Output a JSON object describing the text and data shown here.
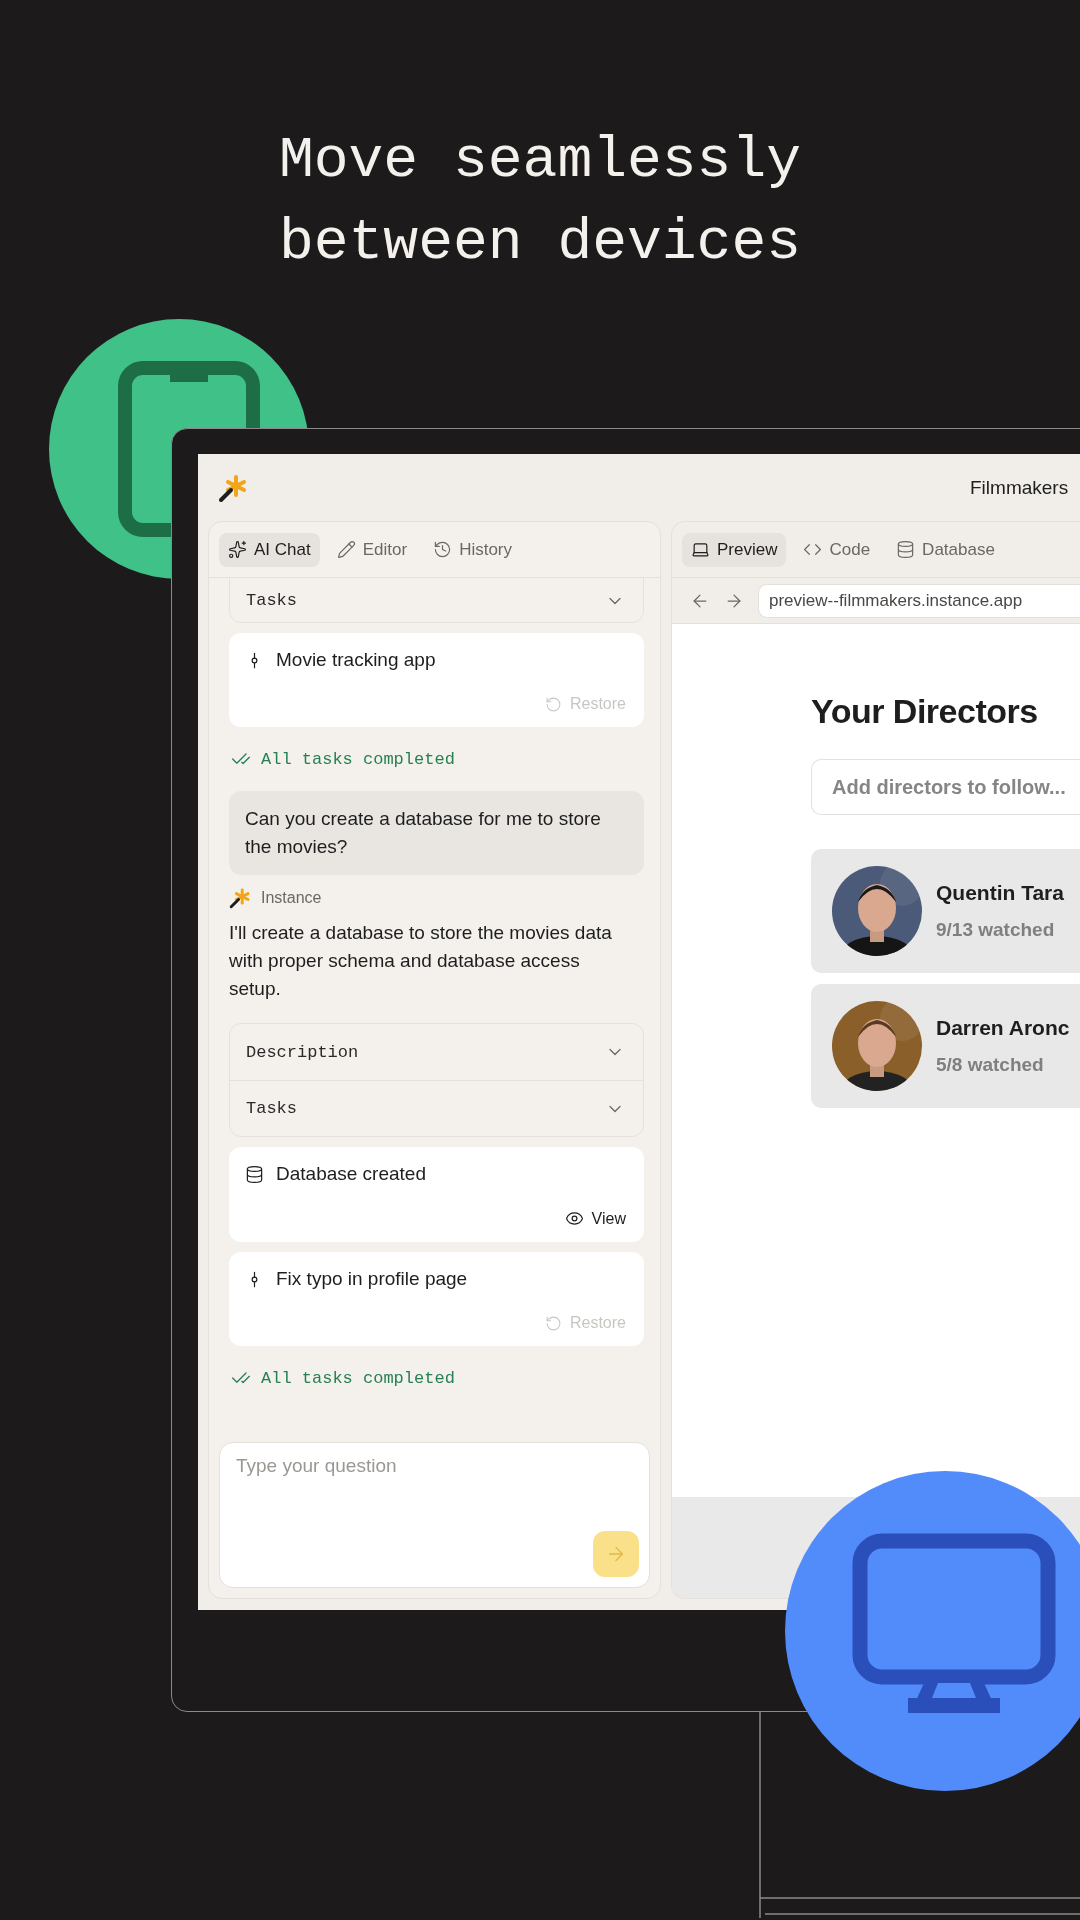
{
  "headline": "Move seamlessly between devices",
  "app": {
    "title": "Filmmakers",
    "chat_tabs": [
      {
        "label": "AI Chat",
        "selected": true
      },
      {
        "label": "Editor",
        "selected": false
      },
      {
        "label": "History",
        "selected": false
      }
    ],
    "chat": [
      {
        "kind": "accordion",
        "sections": [
          {
            "label": "Tasks",
            "expanded": false
          }
        ]
      },
      {
        "kind": "version",
        "title": "Movie tracking app",
        "action": {
          "label": "Restore",
          "kind": "restore",
          "disabled": true
        }
      },
      {
        "kind": "status",
        "text": "All tasks completed"
      },
      {
        "kind": "user",
        "text": "Can you create a database for me to store the movies?"
      },
      {
        "kind": "assistant",
        "name": "Instance",
        "text": "I'll create a database to store the movies data with proper schema and database access setup."
      },
      {
        "kind": "accordion",
        "sections": [
          {
            "label": "Description",
            "expanded": false
          },
          {
            "label": "Tasks",
            "expanded": false
          }
        ]
      },
      {
        "kind": "database",
        "title": "Database created",
        "action": {
          "label": "View",
          "kind": "view",
          "disabled": false
        }
      },
      {
        "kind": "version",
        "title": "Fix typo in profile page",
        "action": {
          "label": "Restore",
          "kind": "restore",
          "disabled": true
        }
      },
      {
        "kind": "status",
        "text": "All tasks completed"
      }
    ],
    "input": {
      "placeholder": "Type your question",
      "send_disabled": true
    },
    "preview_tabs": [
      {
        "label": "Preview",
        "selected": true
      },
      {
        "label": "Code",
        "selected": false
      },
      {
        "label": "Database",
        "selected": false
      }
    ],
    "url": "preview--filmmakers.instance.app",
    "preview": {
      "heading": "Your Directors",
      "search_placeholder": "Add directors to follow...",
      "directors": [
        {
          "name": "Quentin Tara",
          "progress": "9/13 watched"
        },
        {
          "name": "Darren Aronc",
          "progress": "5/8 watched"
        }
      ]
    }
  }
}
